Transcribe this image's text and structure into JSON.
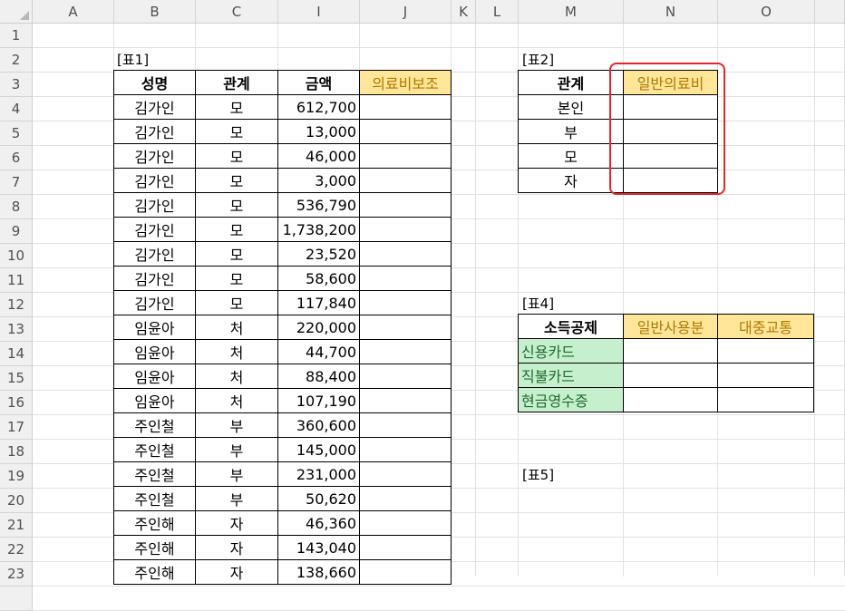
{
  "columns": [
    "A",
    "B",
    "C",
    "I",
    "J",
    "K",
    "L",
    "M",
    "N",
    "O"
  ],
  "rows": [
    "1",
    "2",
    "3",
    "4",
    "5",
    "6",
    "7",
    "8",
    "9",
    "10",
    "11",
    "12",
    "13",
    "14",
    "15",
    "16",
    "17",
    "18",
    "19",
    "20",
    "21",
    "22",
    "23"
  ],
  "table1": {
    "caption": "[표1]",
    "headers": [
      "성명",
      "관계",
      "금액",
      "의료비보조"
    ],
    "rows": [
      [
        "김가인",
        "모",
        "612,700"
      ],
      [
        "김가인",
        "모",
        "13,000"
      ],
      [
        "김가인",
        "모",
        "46,000"
      ],
      [
        "김가인",
        "모",
        "3,000"
      ],
      [
        "김가인",
        "모",
        "536,790"
      ],
      [
        "김가인",
        "모",
        "1,738,200"
      ],
      [
        "김가인",
        "모",
        "23,520"
      ],
      [
        "김가인",
        "모",
        "58,600"
      ],
      [
        "김가인",
        "모",
        "117,840"
      ],
      [
        "임윤아",
        "처",
        "220,000"
      ],
      [
        "임윤아",
        "처",
        "44,700"
      ],
      [
        "임윤아",
        "처",
        "88,400"
      ],
      [
        "임윤아",
        "처",
        "107,190"
      ],
      [
        "주인철",
        "부",
        "360,600"
      ],
      [
        "주인철",
        "부",
        "145,000"
      ],
      [
        "주인철",
        "부",
        "231,000"
      ],
      [
        "주인철",
        "부",
        "50,620"
      ],
      [
        "주인해",
        "자",
        "46,360"
      ],
      [
        "주인해",
        "자",
        "143,040"
      ],
      [
        "주인해",
        "자",
        "138,660"
      ]
    ]
  },
  "table2": {
    "caption": "[표2]",
    "headers": [
      "관계",
      "일반의료비"
    ],
    "rows": [
      "본인",
      "부",
      "모",
      "자"
    ]
  },
  "table4": {
    "caption": "[표4]",
    "headers": [
      "소득공제",
      "일반사용분",
      "대중교통"
    ],
    "rows": [
      "신용카드",
      "직불카드",
      "현금영수증"
    ]
  },
  "table5": {
    "caption": "[표5]"
  },
  "colors": {
    "header_yellow": "#ffe699",
    "label_green": "#c6efce",
    "annotation_red": "#e8242c"
  }
}
